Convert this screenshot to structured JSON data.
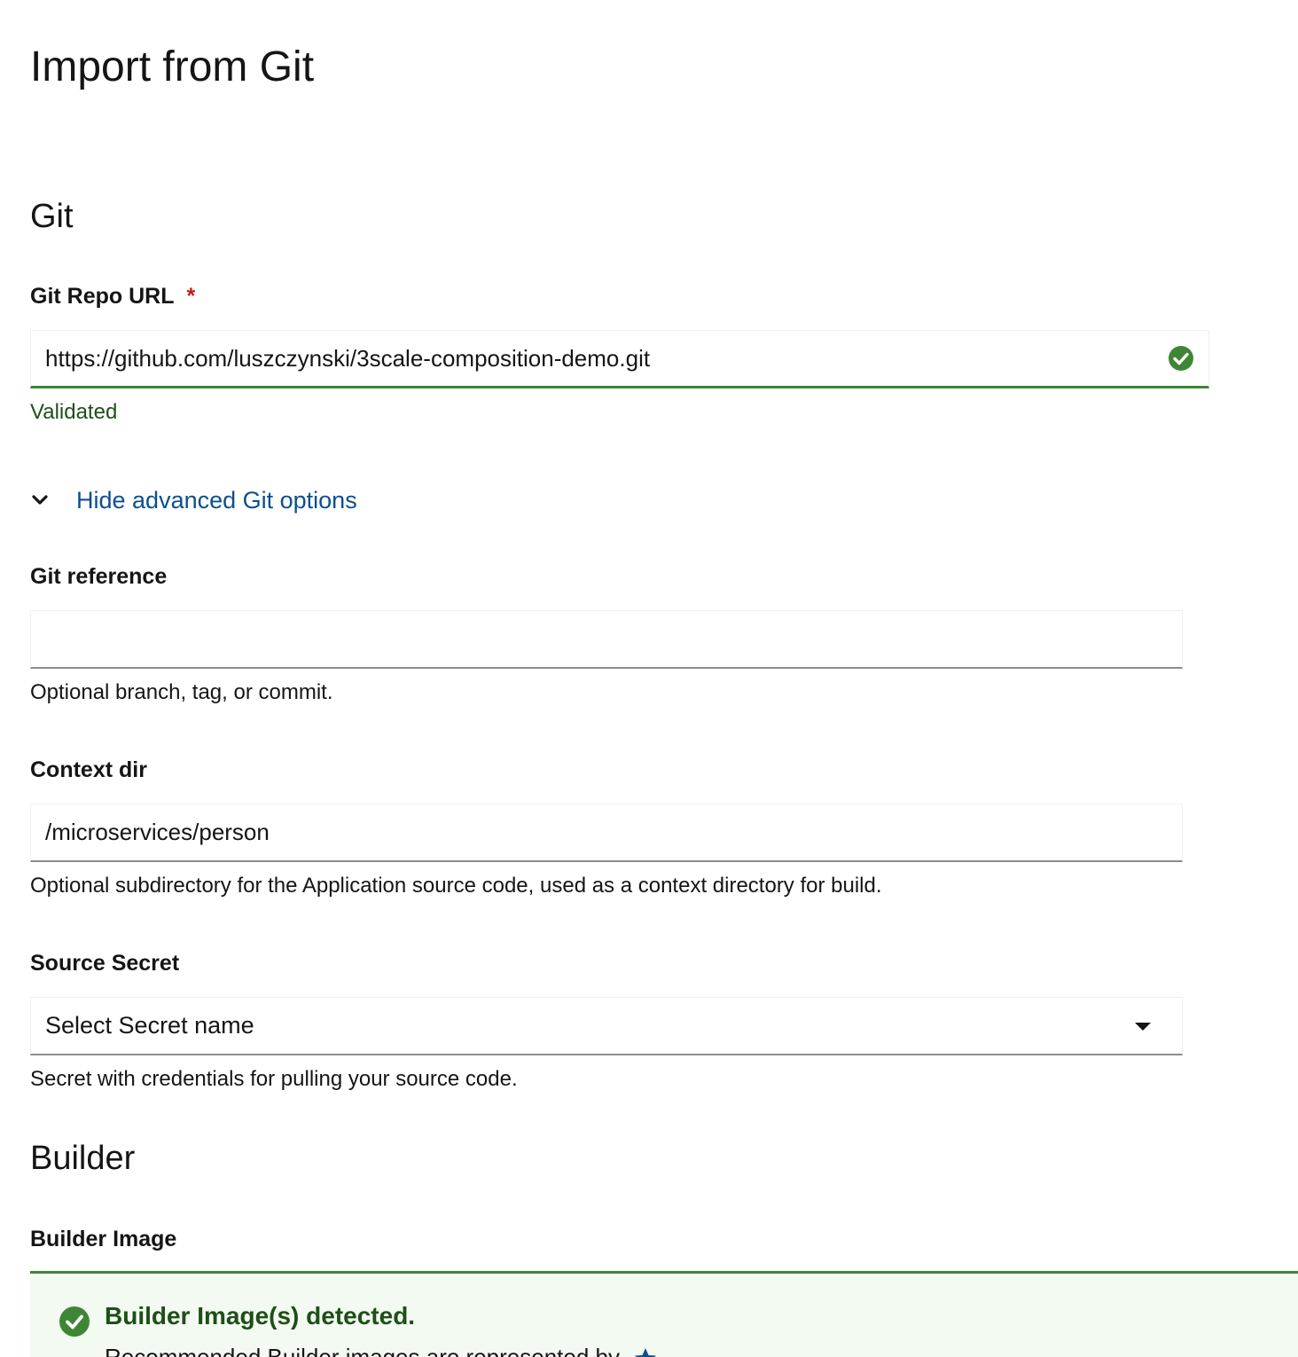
{
  "page": {
    "title": "Import from Git"
  },
  "git_section": {
    "title": "Git",
    "repo_url": {
      "label": "Git Repo URL",
      "required_mark": "*",
      "value": "https://github.com/luszczynski/3scale-composition-demo.git",
      "status_text": "Validated",
      "status_icon": "check-circle-icon",
      "status_color": "#3e8635"
    },
    "advanced_toggle": {
      "label": "Hide advanced Git options",
      "icon": "chevron-down-icon"
    },
    "git_reference": {
      "label": "Git reference",
      "value": "",
      "helper": "Optional branch, tag, or commit."
    },
    "context_dir": {
      "label": "Context dir",
      "value": "/microservices/person",
      "helper": "Optional subdirectory for the Application source code, used as a context directory for build."
    },
    "source_secret": {
      "label": "Source Secret",
      "selected": "Select Secret name",
      "icon": "caret-down-icon",
      "helper": "Secret with credentials for pulling your source code."
    }
  },
  "builder_section": {
    "title": "Builder",
    "builder_image": {
      "label": "Builder Image",
      "alert_title": "Builder Image(s) detected.",
      "alert_icon": "check-circle-icon",
      "alert_subtext": "Recommended Builder images are represented by"
    }
  },
  "colors": {
    "success": "#3e8635",
    "link": "#0b4f8f",
    "required": "#c9190b"
  }
}
